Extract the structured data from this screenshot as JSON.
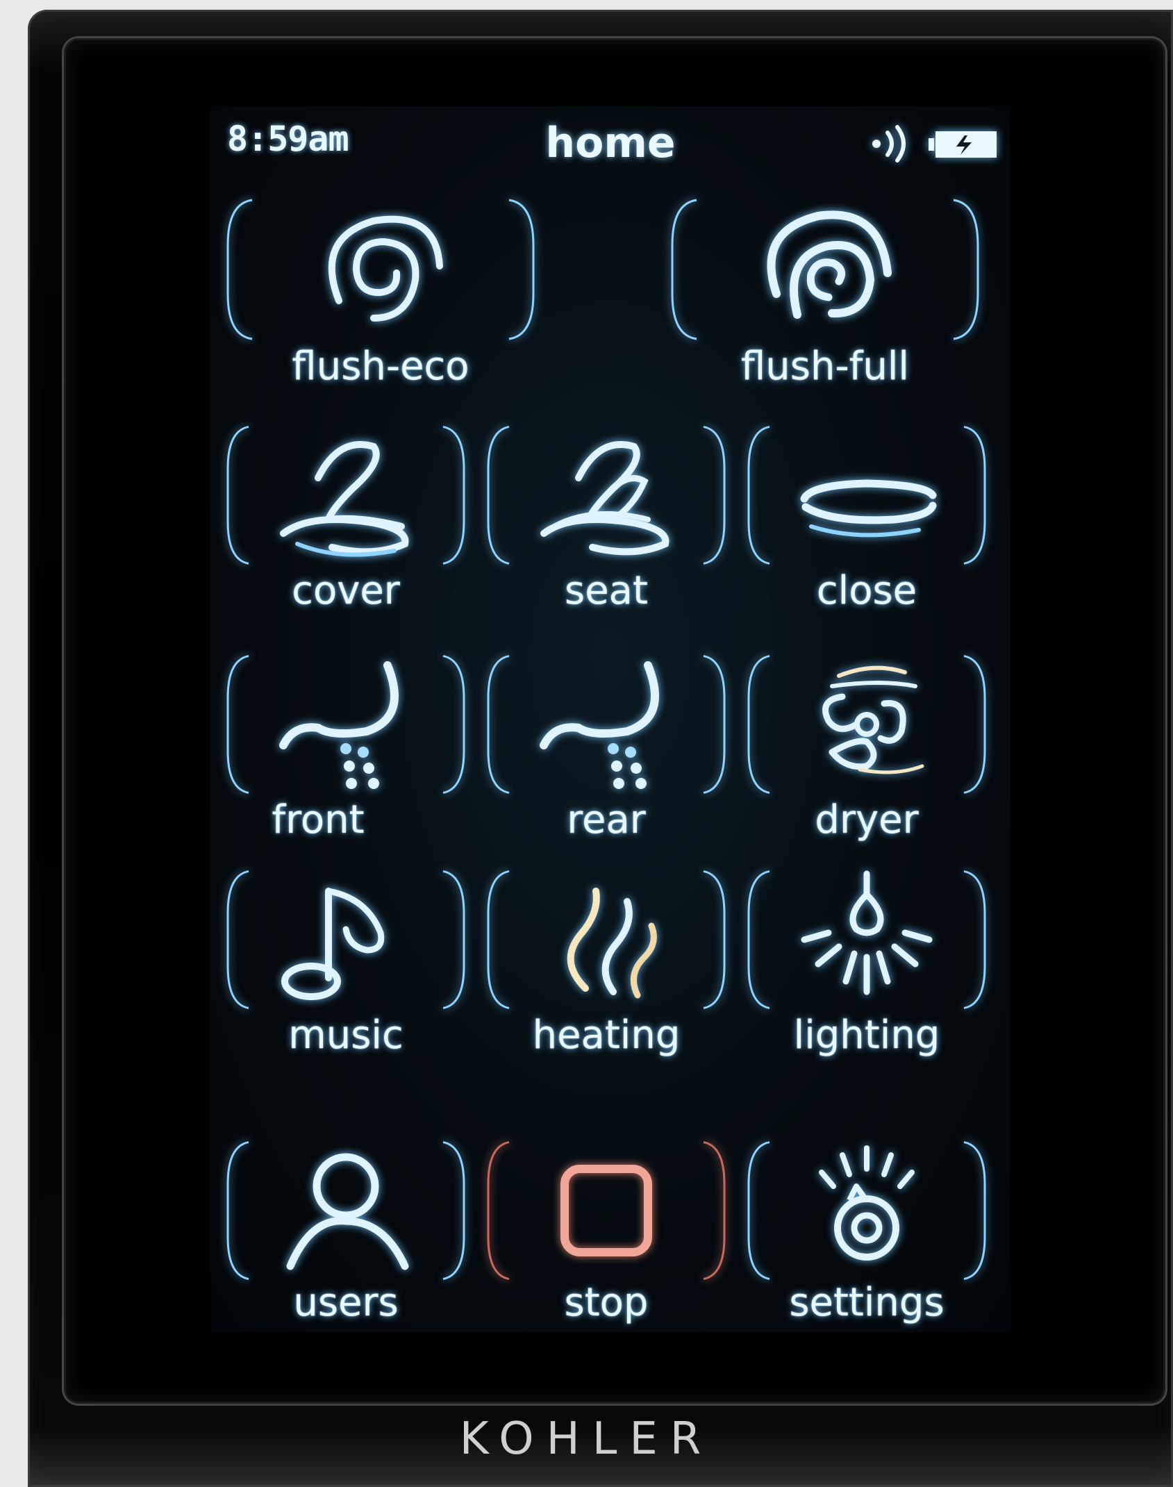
{
  "status": {
    "time": "8:59am",
    "title": "home",
    "sound_icon": "speaker-volume-icon",
    "battery_icon": "battery-charging-icon"
  },
  "buttons": {
    "flush_eco": {
      "label": "flush-eco",
      "icon": "spiral-small-icon"
    },
    "flush_full": {
      "label": "flush-full",
      "icon": "spiral-large-icon"
    },
    "cover": {
      "label": "cover",
      "icon": "lid-open-icon"
    },
    "seat": {
      "label": "seat",
      "icon": "seat-open-icon"
    },
    "close": {
      "label": "close",
      "icon": "lid-close-icon"
    },
    "front": {
      "label": "front",
      "icon": "front-wash-icon"
    },
    "rear": {
      "label": "rear",
      "icon": "rear-wash-icon"
    },
    "dryer": {
      "label": "dryer",
      "icon": "fan-icon"
    },
    "music": {
      "label": "music",
      "icon": "music-note-icon"
    },
    "heating": {
      "label": "heating",
      "icon": "flame-icon"
    },
    "lighting": {
      "label": "lighting",
      "icon": "light-icon"
    },
    "users": {
      "label": "users",
      "icon": "user-icon"
    },
    "stop": {
      "label": "stop",
      "icon": "stop-icon"
    },
    "settings": {
      "label": "settings",
      "icon": "settings-icon"
    }
  },
  "brand": "KOHLER",
  "colors": {
    "glow": "#8fd3ff",
    "stop": "#e88f83",
    "screen": "#050b10"
  }
}
